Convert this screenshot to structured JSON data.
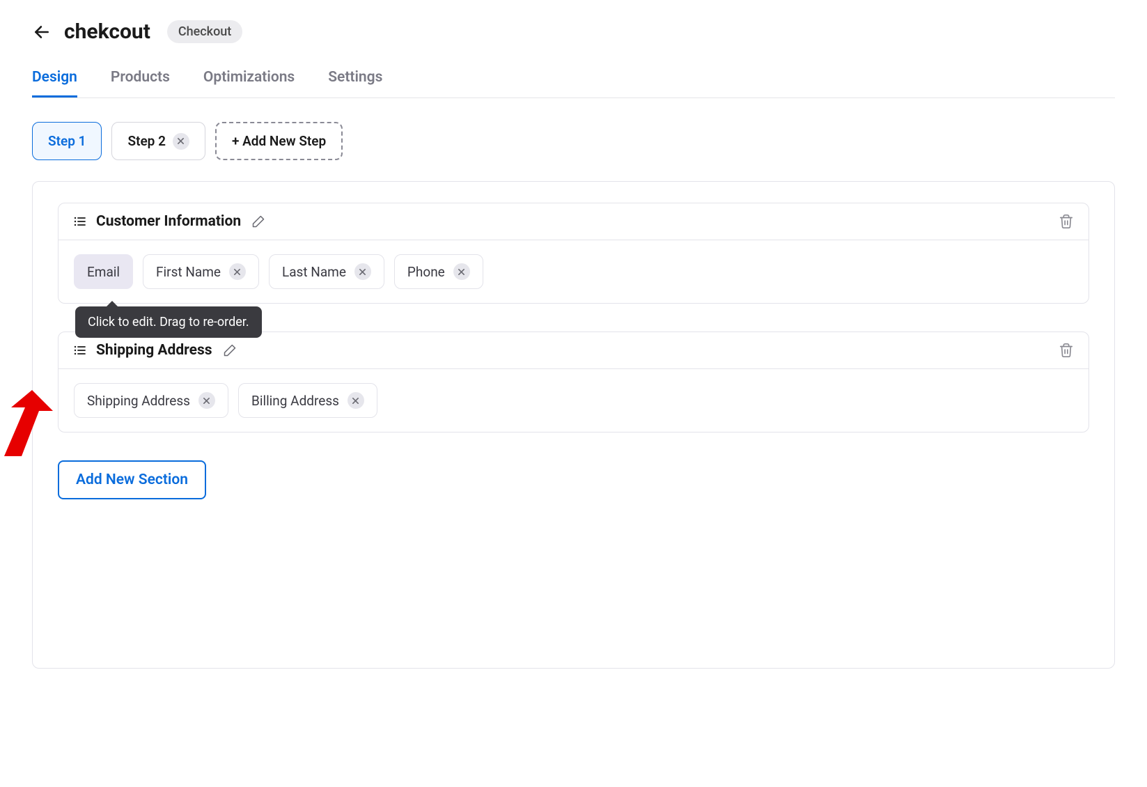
{
  "header": {
    "page_title": "chekcout",
    "badge": "Checkout"
  },
  "tabs": [
    {
      "label": "Design",
      "active": true
    },
    {
      "label": "Products",
      "active": false
    },
    {
      "label": "Optimizations",
      "active": false
    },
    {
      "label": "Settings",
      "active": false
    }
  ],
  "steps": {
    "items": [
      {
        "label": "Step 1",
        "active": true,
        "removable": false
      },
      {
        "label": "Step 2",
        "active": false,
        "removable": true
      }
    ],
    "add_label": "+ Add New Step"
  },
  "sections": [
    {
      "title": "Customer Information",
      "fields": [
        {
          "label": "Email",
          "highlighted": true,
          "removable": false
        },
        {
          "label": "First Name",
          "highlighted": false,
          "removable": true
        },
        {
          "label": "Last Name",
          "highlighted": false,
          "removable": true
        },
        {
          "label": "Phone",
          "highlighted": false,
          "removable": true
        }
      ]
    },
    {
      "title": "Shipping Address",
      "fields": [
        {
          "label": "Shipping Address",
          "highlighted": false,
          "removable": true
        },
        {
          "label": "Billing Address",
          "highlighted": false,
          "removable": true
        }
      ]
    }
  ],
  "tooltip_text": "Click to edit. Drag to re-order.",
  "add_section_label": "Add New Section"
}
